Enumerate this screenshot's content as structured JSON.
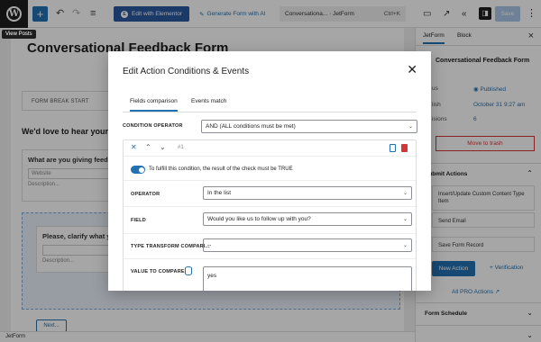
{
  "topbar": {
    "elementor_label": "Edit with Elementor",
    "ai_label": "Generate Form with AI",
    "doc_search": "Conversationa... · JetForm",
    "shortcut": "Ctrl+K",
    "save_label": "Save"
  },
  "tooltip": "View Posts",
  "editor": {
    "title": "Conversational Feedback Form",
    "form_break": "FORM BREAK START",
    "heading": "We'd love to hear your",
    "field1_question": "What are you giving feed",
    "field1_placeholder": "Website",
    "field1_desc": "Description...",
    "field2_question": "Please, clarify what y",
    "field2_desc": "Description...",
    "next_label": "Next..."
  },
  "footer": "JetForm",
  "sidebar": {
    "tab_jetform": "JetForm",
    "tab_block": "Block",
    "form_title": "Conversational Feedback Form",
    "status_label": "us",
    "status_value": "Published",
    "publish_label": "lish",
    "publish_value": "October 31 9:27 am",
    "revisions_label": "isions",
    "revisions_value": "6",
    "trash_label": "Move to trash",
    "submit_section": "Submit Actions",
    "actions": [
      "Insert/Update Custom Content Type Item",
      "Send Email",
      "Save Form Record"
    ],
    "new_action": "New Action",
    "verification": "Verification",
    "all_pro": "All PRO Actions",
    "form_schedule": "Form Schedule"
  },
  "modal": {
    "title": "Edit Action Conditions & Events",
    "tab_fields": "Fields comparison",
    "tab_events": "Events match",
    "condition_operator_label": "CONDITION OPERATOR",
    "condition_operator_value": "AND (ALL conditions must be met)",
    "condition_index": "#1",
    "toggle_label": "To fulfill this condition, the result of the check must be TRUE",
    "operator_label": "OPERATOR",
    "operator_value": "In the list",
    "field_label": "FIELD",
    "field_value": "Would you like us to follow up with you?",
    "transform_label": "TYPE TRANSFORM COMPARI...",
    "transform_value": "--",
    "value_label": "VALUE TO COMPARE",
    "value_value": "yes"
  },
  "colors": {
    "accent": "#2271b1",
    "danger": "#d63638",
    "elementor": "#2c5aa0",
    "published": "#2271b1"
  }
}
